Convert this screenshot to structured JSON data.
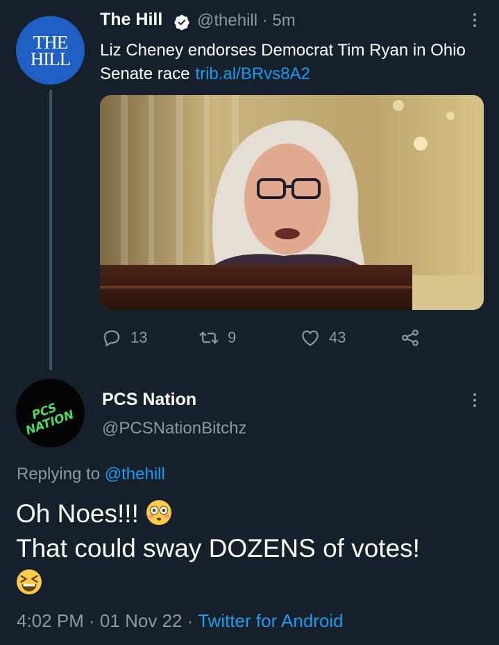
{
  "parent_tweet": {
    "avatar_text": [
      "THE",
      "HILL"
    ],
    "display_name": "The Hill",
    "handle_time": "@thehill · 5m",
    "text": "Liz Cheney endorses Democrat Tim Ryan in Ohio Senate race",
    "link": "trib.al/BRvs8A2",
    "actions": {
      "replies": "13",
      "retweets": "9",
      "likes": "43"
    }
  },
  "reply_tweet": {
    "avatar_text": [
      "PCS",
      "NATION"
    ],
    "display_name": "PCS Nation",
    "handle": "@PCSNationBitchz",
    "replying_prefix": "Replying to",
    "replying_to": "@thehill",
    "text_line1": "Oh Noes!!!",
    "text_line2": "That could sway DOZENS of votes!",
    "time": "4:02 PM · 01 Nov 22 ·",
    "source": "Twitter for Android"
  },
  "colors": {
    "background": "#15202b",
    "secondary_text": "#8b98a5",
    "link": "#1d9bf0",
    "verified": "#ffffff",
    "pcs_avatar_text": "#4cd964"
  },
  "icons": [
    "verified-icon",
    "more-icon",
    "reply-icon",
    "retweet-icon",
    "like-icon",
    "share-icon",
    "flushed-face-emoji",
    "grinning-squinting-face-emoji"
  ]
}
